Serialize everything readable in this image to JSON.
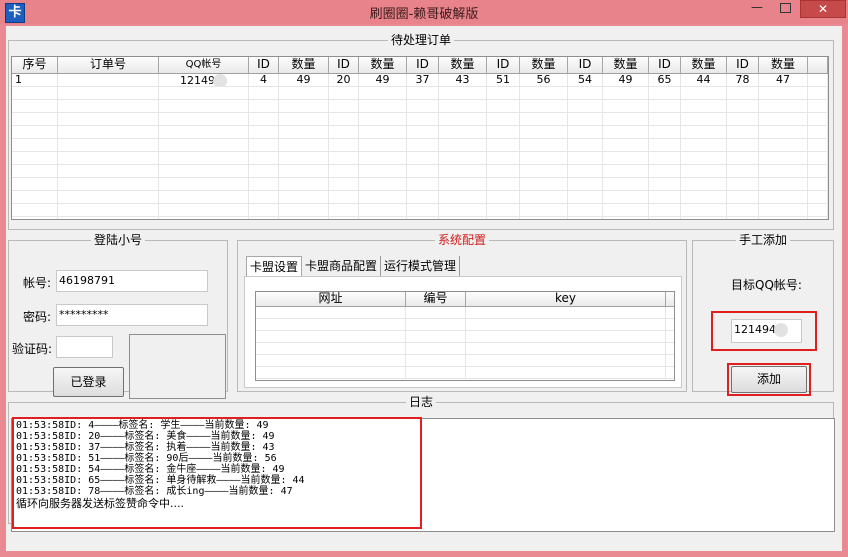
{
  "window": {
    "title": "刷圈圈-赖哥破解版",
    "icon_glyph": "卡",
    "minimize_glyph": "—",
    "close_glyph": "✕"
  },
  "orders": {
    "legend": "待处理订单",
    "columns": [
      "序号",
      "订单号",
      "QQ帐号",
      "ID",
      "数量",
      "ID",
      "数量",
      "ID",
      "数量",
      "ID",
      "数量",
      "ID",
      "数量",
      "ID",
      "数量",
      "ID",
      "数量"
    ],
    "rows": [
      [
        "1",
        "",
        "12149",
        "4",
        "49",
        "20",
        "49",
        "37",
        "43",
        "51",
        "56",
        "54",
        "49",
        "65",
        "44",
        "78",
        "47"
      ]
    ]
  },
  "login": {
    "legend": "登陆小号",
    "account_label": "帐号:",
    "account_value": "46198791",
    "password_label": "密码:",
    "password_value": "*********",
    "captcha_label": "验证码:",
    "captcha_value": "",
    "login_button": "已登录"
  },
  "config": {
    "legend": "系统配置",
    "tabs": [
      "卡盟设置",
      "卡盟商品配置",
      "运行模式管理"
    ],
    "table_columns": [
      "网址",
      "编号",
      "key"
    ]
  },
  "manual": {
    "legend": "手工添加",
    "target_label": "目标QQ帐号:",
    "target_value": "121494",
    "add_button": "添加"
  },
  "log": {
    "legend": "日志",
    "lines": [
      "01:53:58ID: 4————标签名: 学生————当前数量: 49",
      "01:53:58ID: 20————标签名: 美食————当前数量: 49",
      "01:53:58ID: 37————标签名: 执着————当前数量: 43",
      "01:53:58ID: 51————标签名: 90后————当前数量: 56",
      "01:53:58ID: 54————标签名: 金牛座————当前数量: 49",
      "01:53:58ID: 65————标签名: 单身待解救————当前数量: 44",
      "01:53:58ID: 78————标签名: 成长ing————当前数量: 47",
      "循环向服务器发送标签赞命令中...."
    ]
  }
}
